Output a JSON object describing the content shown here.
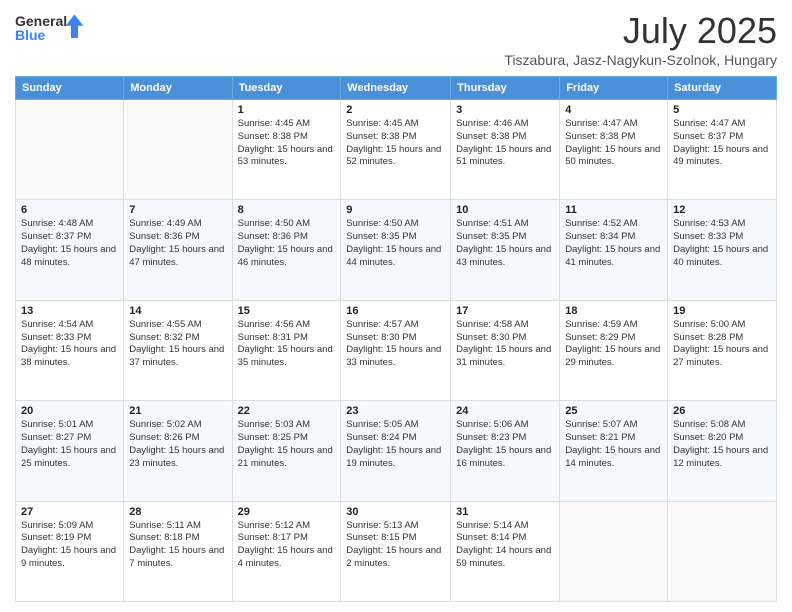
{
  "header": {
    "logo_general": "General",
    "logo_blue": "Blue",
    "month_title": "July 2025",
    "location": "Tiszabura, Jasz-Nagykun-Szolnok, Hungary"
  },
  "days_of_week": [
    "Sunday",
    "Monday",
    "Tuesday",
    "Wednesday",
    "Thursday",
    "Friday",
    "Saturday"
  ],
  "weeks": [
    [
      {
        "day": "",
        "sunrise": "",
        "sunset": "",
        "daylight": ""
      },
      {
        "day": "",
        "sunrise": "",
        "sunset": "",
        "daylight": ""
      },
      {
        "day": "1",
        "sunrise": "Sunrise: 4:45 AM",
        "sunset": "Sunset: 8:38 PM",
        "daylight": "Daylight: 15 hours and 53 minutes."
      },
      {
        "day": "2",
        "sunrise": "Sunrise: 4:45 AM",
        "sunset": "Sunset: 8:38 PM",
        "daylight": "Daylight: 15 hours and 52 minutes."
      },
      {
        "day": "3",
        "sunrise": "Sunrise: 4:46 AM",
        "sunset": "Sunset: 8:38 PM",
        "daylight": "Daylight: 15 hours and 51 minutes."
      },
      {
        "day": "4",
        "sunrise": "Sunrise: 4:47 AM",
        "sunset": "Sunset: 8:38 PM",
        "daylight": "Daylight: 15 hours and 50 minutes."
      },
      {
        "day": "5",
        "sunrise": "Sunrise: 4:47 AM",
        "sunset": "Sunset: 8:37 PM",
        "daylight": "Daylight: 15 hours and 49 minutes."
      }
    ],
    [
      {
        "day": "6",
        "sunrise": "Sunrise: 4:48 AM",
        "sunset": "Sunset: 8:37 PM",
        "daylight": "Daylight: 15 hours and 48 minutes."
      },
      {
        "day": "7",
        "sunrise": "Sunrise: 4:49 AM",
        "sunset": "Sunset: 8:36 PM",
        "daylight": "Daylight: 15 hours and 47 minutes."
      },
      {
        "day": "8",
        "sunrise": "Sunrise: 4:50 AM",
        "sunset": "Sunset: 8:36 PM",
        "daylight": "Daylight: 15 hours and 46 minutes."
      },
      {
        "day": "9",
        "sunrise": "Sunrise: 4:50 AM",
        "sunset": "Sunset: 8:35 PM",
        "daylight": "Daylight: 15 hours and 44 minutes."
      },
      {
        "day": "10",
        "sunrise": "Sunrise: 4:51 AM",
        "sunset": "Sunset: 8:35 PM",
        "daylight": "Daylight: 15 hours and 43 minutes."
      },
      {
        "day": "11",
        "sunrise": "Sunrise: 4:52 AM",
        "sunset": "Sunset: 8:34 PM",
        "daylight": "Daylight: 15 hours and 41 minutes."
      },
      {
        "day": "12",
        "sunrise": "Sunrise: 4:53 AM",
        "sunset": "Sunset: 8:33 PM",
        "daylight": "Daylight: 15 hours and 40 minutes."
      }
    ],
    [
      {
        "day": "13",
        "sunrise": "Sunrise: 4:54 AM",
        "sunset": "Sunset: 8:33 PM",
        "daylight": "Daylight: 15 hours and 38 minutes."
      },
      {
        "day": "14",
        "sunrise": "Sunrise: 4:55 AM",
        "sunset": "Sunset: 8:32 PM",
        "daylight": "Daylight: 15 hours and 37 minutes."
      },
      {
        "day": "15",
        "sunrise": "Sunrise: 4:56 AM",
        "sunset": "Sunset: 8:31 PM",
        "daylight": "Daylight: 15 hours and 35 minutes."
      },
      {
        "day": "16",
        "sunrise": "Sunrise: 4:57 AM",
        "sunset": "Sunset: 8:30 PM",
        "daylight": "Daylight: 15 hours and 33 minutes."
      },
      {
        "day": "17",
        "sunrise": "Sunrise: 4:58 AM",
        "sunset": "Sunset: 8:30 PM",
        "daylight": "Daylight: 15 hours and 31 minutes."
      },
      {
        "day": "18",
        "sunrise": "Sunrise: 4:59 AM",
        "sunset": "Sunset: 8:29 PM",
        "daylight": "Daylight: 15 hours and 29 minutes."
      },
      {
        "day": "19",
        "sunrise": "Sunrise: 5:00 AM",
        "sunset": "Sunset: 8:28 PM",
        "daylight": "Daylight: 15 hours and 27 minutes."
      }
    ],
    [
      {
        "day": "20",
        "sunrise": "Sunrise: 5:01 AM",
        "sunset": "Sunset: 8:27 PM",
        "daylight": "Daylight: 15 hours and 25 minutes."
      },
      {
        "day": "21",
        "sunrise": "Sunrise: 5:02 AM",
        "sunset": "Sunset: 8:26 PM",
        "daylight": "Daylight: 15 hours and 23 minutes."
      },
      {
        "day": "22",
        "sunrise": "Sunrise: 5:03 AM",
        "sunset": "Sunset: 8:25 PM",
        "daylight": "Daylight: 15 hours and 21 minutes."
      },
      {
        "day": "23",
        "sunrise": "Sunrise: 5:05 AM",
        "sunset": "Sunset: 8:24 PM",
        "daylight": "Daylight: 15 hours and 19 minutes."
      },
      {
        "day": "24",
        "sunrise": "Sunrise: 5:06 AM",
        "sunset": "Sunset: 8:23 PM",
        "daylight": "Daylight: 15 hours and 16 minutes."
      },
      {
        "day": "25",
        "sunrise": "Sunrise: 5:07 AM",
        "sunset": "Sunset: 8:21 PM",
        "daylight": "Daylight: 15 hours and 14 minutes."
      },
      {
        "day": "26",
        "sunrise": "Sunrise: 5:08 AM",
        "sunset": "Sunset: 8:20 PM",
        "daylight": "Daylight: 15 hours and 12 minutes."
      }
    ],
    [
      {
        "day": "27",
        "sunrise": "Sunrise: 5:09 AM",
        "sunset": "Sunset: 8:19 PM",
        "daylight": "Daylight: 15 hours and 9 minutes."
      },
      {
        "day": "28",
        "sunrise": "Sunrise: 5:11 AM",
        "sunset": "Sunset: 8:18 PM",
        "daylight": "Daylight: 15 hours and 7 minutes."
      },
      {
        "day": "29",
        "sunrise": "Sunrise: 5:12 AM",
        "sunset": "Sunset: 8:17 PM",
        "daylight": "Daylight: 15 hours and 4 minutes."
      },
      {
        "day": "30",
        "sunrise": "Sunrise: 5:13 AM",
        "sunset": "Sunset: 8:15 PM",
        "daylight": "Daylight: 15 hours and 2 minutes."
      },
      {
        "day": "31",
        "sunrise": "Sunrise: 5:14 AM",
        "sunset": "Sunset: 8:14 PM",
        "daylight": "Daylight: 14 hours and 59 minutes."
      },
      {
        "day": "",
        "sunrise": "",
        "sunset": "",
        "daylight": ""
      },
      {
        "day": "",
        "sunrise": "",
        "sunset": "",
        "daylight": ""
      }
    ]
  ]
}
